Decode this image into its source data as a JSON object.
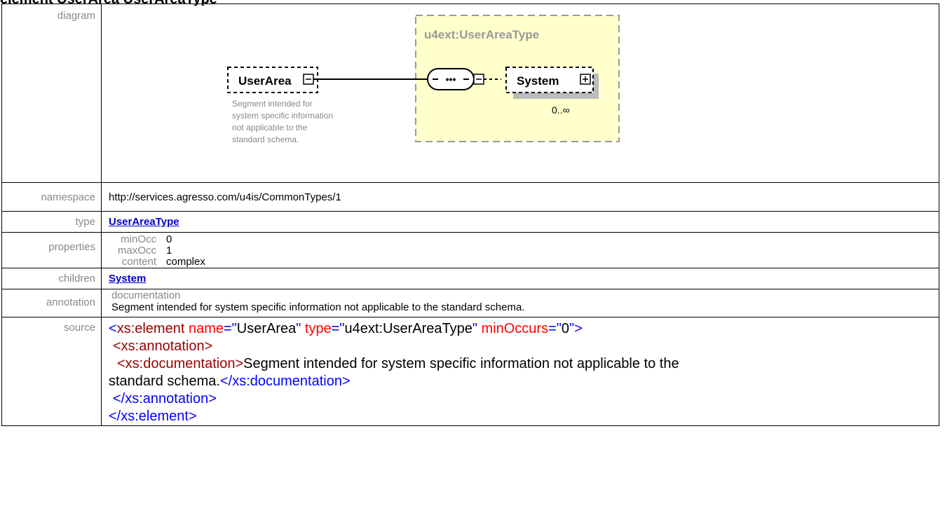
{
  "page": {
    "title": "element UserArea UserAreaType"
  },
  "labels": {
    "diagram": "diagram",
    "namespace": "namespace",
    "type": "type",
    "properties": "properties",
    "children": "children",
    "annotation": "annotation",
    "source": "source"
  },
  "diagram": {
    "group_title": "u4ext:UserAreaType",
    "element_name": "UserArea",
    "element_doc_lines": [
      "Segment intended for",
      "system specific information",
      "not applicable to the",
      "standard schema."
    ],
    "child_name": "System",
    "child_occurs": "0..∞",
    "sequence_symbol": "•••"
  },
  "namespace": "http://services.agresso.com/u4is/CommonTypes/1",
  "type": "UserAreaType",
  "properties": [
    {
      "key": "minOcc",
      "value": "0"
    },
    {
      "key": "maxOcc",
      "value": "1"
    },
    {
      "key": "content",
      "value": "complex"
    }
  ],
  "children": [
    "System"
  ],
  "annotation": {
    "heading": "documentation",
    "text": "Segment intended for system specific information not applicable to the standard schema."
  },
  "source": {
    "l1_open": "<",
    "l1_tag": "xs:element",
    "l1_attr1": " name",
    "l1_eq1": "=\"",
    "l1_val1": "UserArea",
    "l1_q1": "\"",
    "l1_attr2": " type",
    "l1_eq2": "=\"",
    "l1_val2": "u4ext:UserAreaType",
    "l1_q2": "\"",
    "l1_attr3": " minOccurs",
    "l1_eq3": "=\"",
    "l1_val3": "0",
    "l1_close": "\">",
    "l2": "<xs:annotation>",
    "l3_open": "<xs:documentation>",
    "l3_text": "Segment intended for system specific information not applicable to the",
    "l4_text": "standard schema.",
    "l4_close": "</xs:documentation>",
    "l5": "</xs:annotation>",
    "l6": "</xs:element>"
  }
}
